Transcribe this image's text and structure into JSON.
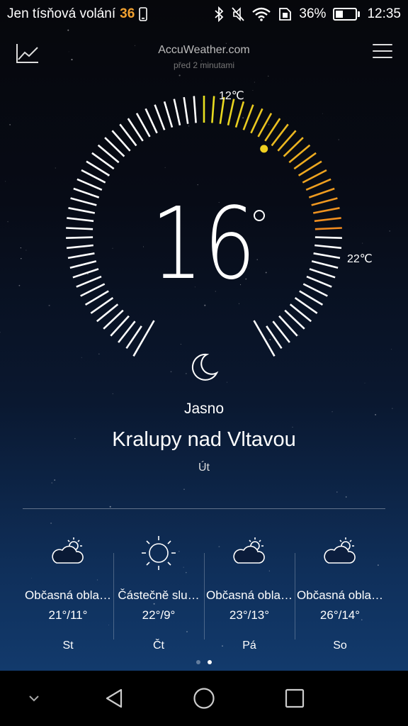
{
  "status_bar": {
    "carrier": "Jen tísňová volání",
    "carrier_number": "36",
    "battery_percent": "36%",
    "battery_level": 0.36,
    "time": "12:35",
    "icons": [
      "phone-icon",
      "bluetooth-icon",
      "mute-icon",
      "wifi-icon",
      "sim-icon"
    ]
  },
  "header": {
    "source": "AccuWeather.com",
    "updated": "před 2 minutami",
    "left_icon": "chart-icon",
    "right_icon": "menu-icon"
  },
  "dial": {
    "current_temp": "16",
    "min_label": "12℃",
    "max_label": "22℃",
    "min_temp": 12,
    "max_temp": 22,
    "current_value": 16,
    "colors": {
      "ticks": "#ffffff",
      "range_start": "#e8e020",
      "range_end": "#f08a20",
      "marker": "#f0d020"
    }
  },
  "current": {
    "condition_icon": "moon-icon",
    "condition": "Jasno",
    "city": "Kralupy nad Vltavou",
    "day": "Út"
  },
  "forecast": [
    {
      "icon": "partly-cloudy-icon",
      "description": "Občasná obla…",
      "temps": "21°/11°",
      "day": "St"
    },
    {
      "icon": "sun-icon",
      "description": "Částečně slu…",
      "temps": "22°/9°",
      "day": "Čt"
    },
    {
      "icon": "partly-cloudy-icon",
      "description": "Občasná obla…",
      "temps": "23°/13°",
      "day": "Pá"
    },
    {
      "icon": "partly-cloudy-icon",
      "description": "Občasná obla…",
      "temps": "26°/14°",
      "day": "So"
    }
  ],
  "pager": {
    "pages": 2,
    "active": 1
  },
  "nav_bar": {
    "buttons": [
      "collapse-icon",
      "back-icon",
      "home-icon",
      "recents-icon"
    ]
  }
}
